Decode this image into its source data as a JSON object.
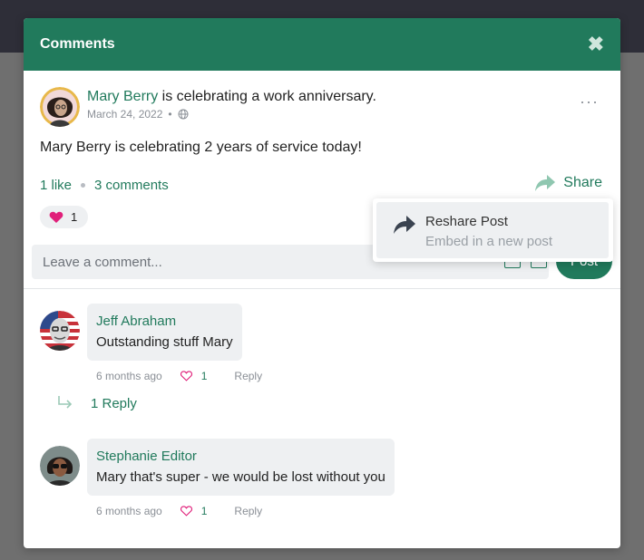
{
  "modal": {
    "title": "Comments",
    "close_label": "✖"
  },
  "post": {
    "author": "Mary Berry",
    "headline_rest": " is celebrating a work anniversary.",
    "date": "March 24, 2022",
    "date_sep": "•",
    "more_label": "···",
    "body": "Mary Berry is celebrating 2 years of service today!",
    "likes_label": "1 like",
    "comments_label": "3 comments",
    "share_label": "Share",
    "reaction_count": "1"
  },
  "composer": {
    "placeholder": "Leave a comment...",
    "post_label": "Post"
  },
  "share_menu": {
    "title": "Reshare Post",
    "subtitle": "Embed in a new post"
  },
  "comments": [
    {
      "author": "Jeff Abraham",
      "text": "Outstanding stuff Mary",
      "time": "6 months ago",
      "likes": "1",
      "reply_label": "Reply",
      "replies_label": "1 Reply"
    },
    {
      "author": "Stephanie Editor",
      "text": "Mary that's super - we would be lost without you",
      "time": "6 months ago",
      "likes": "1",
      "reply_label": "Reply"
    }
  ],
  "colors": {
    "accent": "#217a5c",
    "heart": "#e0207a",
    "bubble": "#eef0f2"
  },
  "icons": {
    "close": "close-icon",
    "globe": "globe-icon",
    "share": "share-arrow-icon",
    "heart": "heart-icon",
    "reply_arrow": "reply-arrow-icon"
  }
}
